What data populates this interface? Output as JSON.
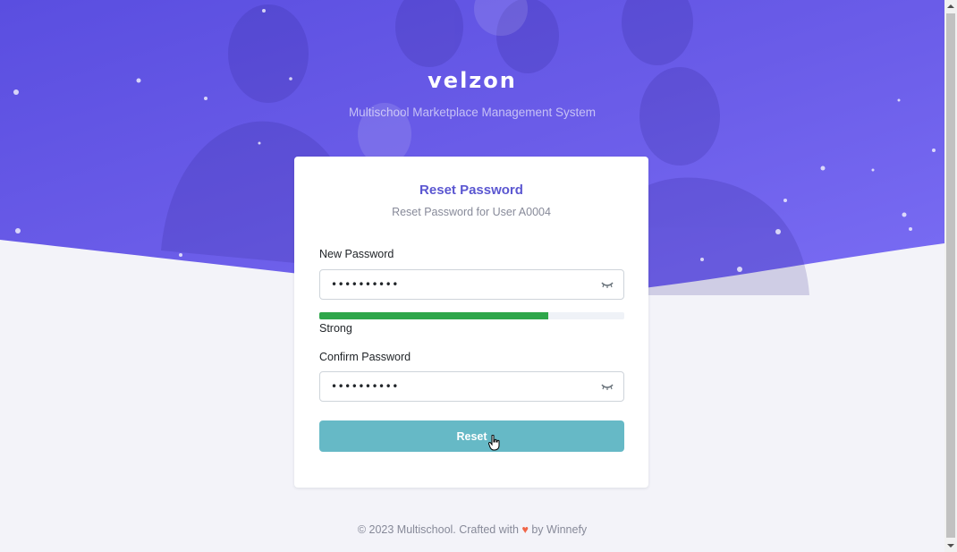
{
  "brand": {
    "logo_text": "velzon",
    "tagline": "Multischool Marketplace Management System"
  },
  "card": {
    "title": "Reset Password",
    "subtitle": "Reset Password for User A0004",
    "new_password": {
      "label": "New Password",
      "value": "••••••••••",
      "toggle_icon": "eye-icon"
    },
    "strength": {
      "label": "Strong",
      "fraction": 0.75,
      "color": "#2ea64a"
    },
    "confirm_password": {
      "label": "Confirm Password",
      "value": "••••••••••",
      "toggle_icon": "eye-icon"
    },
    "reset_label": "Reset"
  },
  "footer": {
    "prefix": "© 2023 Multischool. Crafted with",
    "heart": "♥",
    "suffix": "by Winnefy"
  },
  "colors": {
    "hero_gradient_start": "#5b4fe0",
    "hero_gradient_end": "#7b6cf6",
    "accent": "#5b57d1",
    "button": "#66b9c6",
    "background": "#f3f3f9"
  }
}
